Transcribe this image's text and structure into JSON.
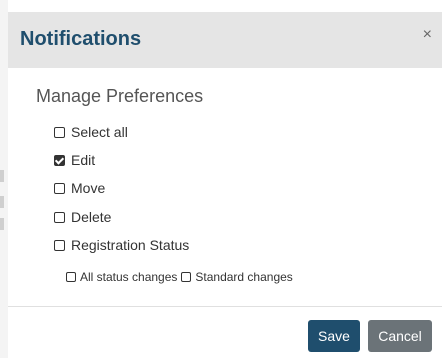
{
  "dialog": {
    "title": "Notifications",
    "close_label": "×",
    "subtitle": "Manage Preferences",
    "options": [
      {
        "label": "Select all",
        "checked": false
      },
      {
        "label": "Edit",
        "checked": true
      },
      {
        "label": "Move",
        "checked": false
      },
      {
        "label": "Delete",
        "checked": false
      },
      {
        "label": "Registration Status",
        "checked": false
      }
    ],
    "sub_options": [
      {
        "label": "All status changes",
        "checked": false
      },
      {
        "label": "Standard changes",
        "checked": false
      }
    ],
    "buttons": {
      "save": "Save",
      "cancel": "Cancel"
    }
  },
  "colors": {
    "header_bg": "#e5e5e5",
    "title": "#1f4e6d",
    "save_bg": "#1f4e6d",
    "cancel_bg": "#6b7378"
  }
}
